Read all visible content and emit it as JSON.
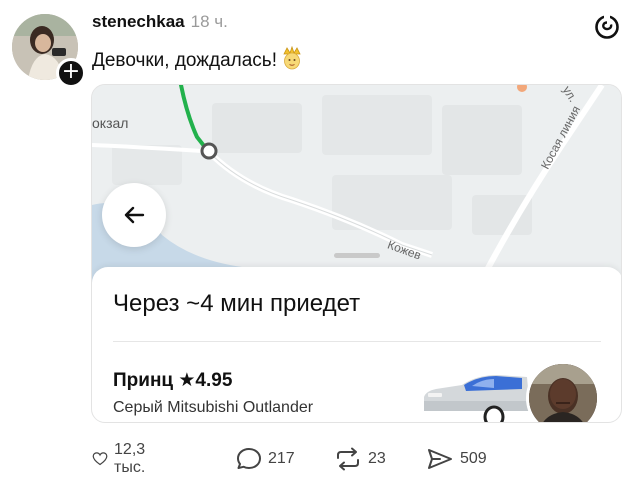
{
  "post": {
    "username": "stenechkaa",
    "time": "18 ч.",
    "text": "Девочки, дождалась!",
    "text_emoji": "crown-face-emoji",
    "follow_symbol": "+"
  },
  "media": {
    "map": {
      "station_label": "окзал",
      "street_1": "Косая линия",
      "street_2": "ул.",
      "street_3": "Кожев",
      "route_color": "#22b14c"
    },
    "eta": "Через ~4 мин приедет",
    "driver_name": "Принц",
    "rating": "★4.95",
    "car": "Серый Mitsubishi Outlander"
  },
  "actions": {
    "likes": "12,3 тыс.",
    "replies": "217",
    "reposts": "23",
    "shares": "509"
  },
  "icons": {
    "brand": "threads-logo-icon",
    "like": "heart-icon",
    "reply": "speech-bubble-icon",
    "repost": "repost-icon",
    "share": "send-icon",
    "back": "arrow-left-icon"
  }
}
